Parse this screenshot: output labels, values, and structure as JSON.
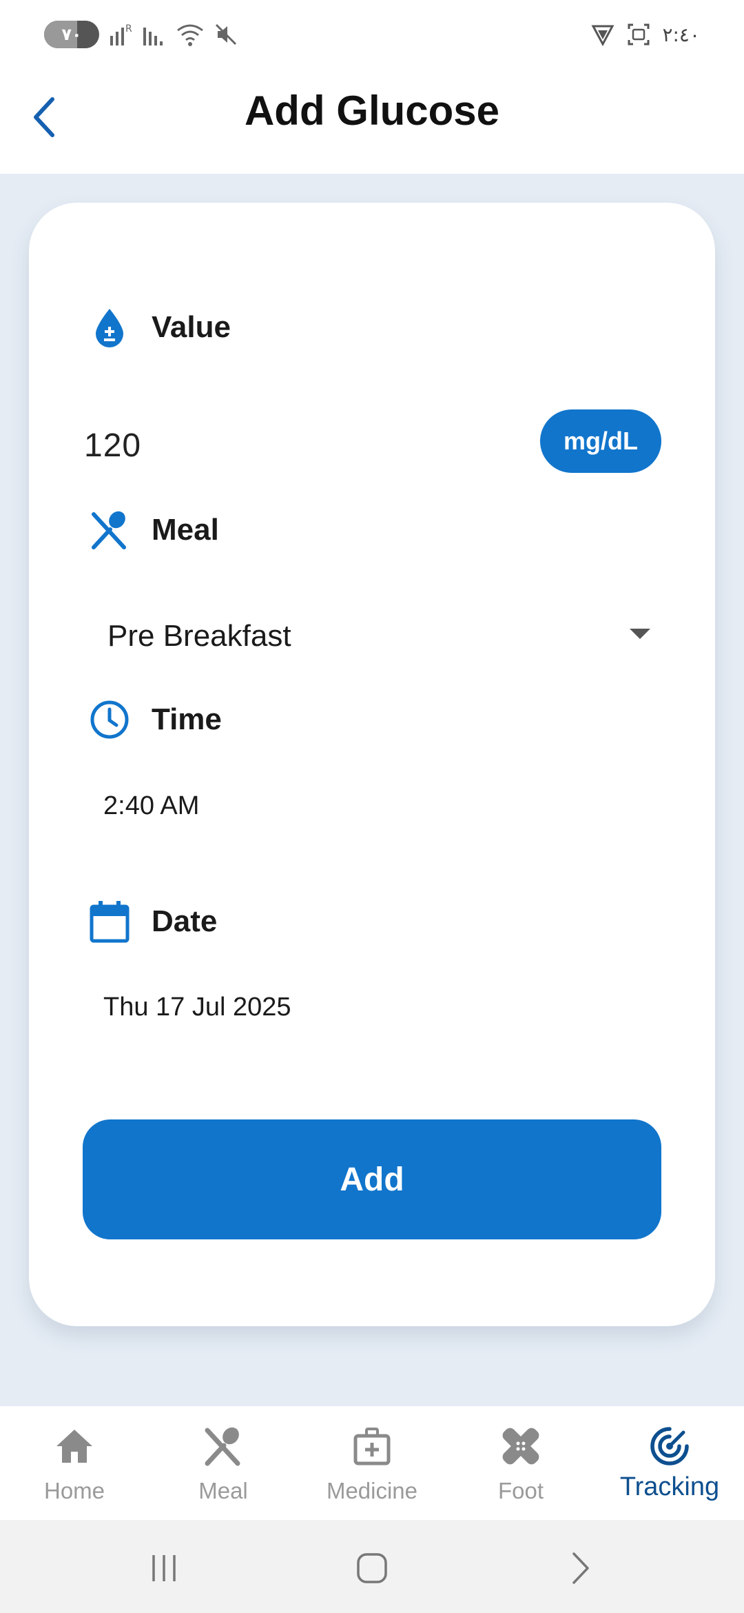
{
  "status_bar": {
    "battery": "٧٠",
    "time": "٢:٤٠"
  },
  "header": {
    "title": "Add Glucose"
  },
  "form": {
    "value_label": "Value",
    "value": "120",
    "unit": "mg/dL",
    "meal_label": "Meal",
    "meal_selected": "Pre Breakfast",
    "time_label": "Time",
    "time_value": "2:40 AM",
    "date_label": "Date",
    "date_value": "Thu 17 Jul 2025",
    "submit_label": "Add"
  },
  "bottom_nav": {
    "items": [
      {
        "label": "Home",
        "icon": "home-icon"
      },
      {
        "label": "Meal",
        "icon": "fork-spoon-icon"
      },
      {
        "label": "Medicine",
        "icon": "medical-kit-icon"
      },
      {
        "label": "Foot",
        "icon": "bandage-icon"
      },
      {
        "label": "Tracking",
        "icon": "tracking-target-icon"
      }
    ],
    "active_index": 4
  },
  "colors": {
    "accent": "#1175cc",
    "active_nav": "#0d4f8f",
    "background": "#e5ecf4"
  }
}
